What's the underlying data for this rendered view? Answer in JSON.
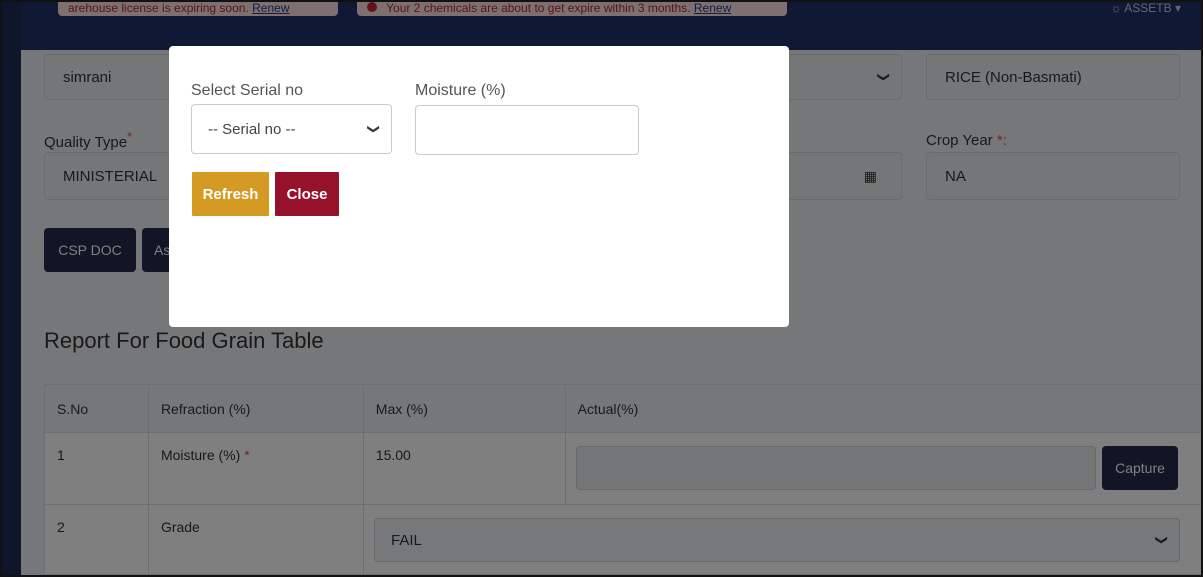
{
  "alerts": {
    "first_text": "arehouse license is expiring soon.",
    "first_link": "Renew",
    "second_text": "Your 2 chemicals are about to get expire within 3 months.",
    "second_link": "Renew"
  },
  "header": {
    "user": "ASSETB"
  },
  "form": {
    "user_value": "simrani",
    "commodity_value": "RICE (Non-Basmati)",
    "quality_type_label": "Quality Type",
    "quality_type_value": "MINISTERIAL",
    "crop_year_label": "Crop Year",
    "crop_year_value": "NA",
    "required_mark": "*",
    "required_colon_mark": "*:"
  },
  "buttons": {
    "csp_doc": "CSP DOC",
    "partial": "As"
  },
  "report": {
    "heading": "Report For Food Grain Table",
    "columns": [
      "S.No",
      "Refraction (%)",
      "Max (%)",
      "Actual(%)"
    ],
    "rows": [
      {
        "sno": "1",
        "refraction": "Moisture (%)",
        "max": "15.00"
      },
      {
        "sno": "2",
        "refraction": "Grade",
        "grade_value": "FAIL"
      }
    ],
    "capture_label": "Capture"
  },
  "modal": {
    "serial_label": "Select Serial no",
    "serial_value": "-- Serial no --",
    "moisture_label": "Moisture (%)",
    "moisture_value": "",
    "refresh_label": "Refresh",
    "close_label": "Close"
  },
  "colors": {
    "topbar": "#233169",
    "refresh": "#d49a23",
    "close": "#96122a",
    "dark_button": "#252a4a"
  }
}
